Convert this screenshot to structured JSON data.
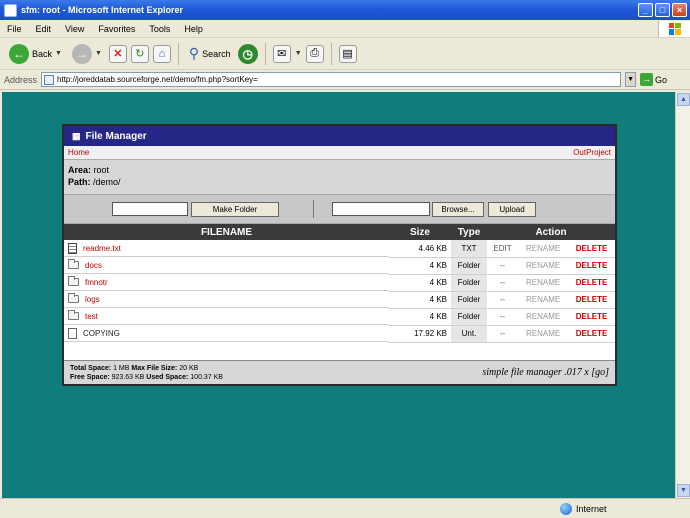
{
  "window": {
    "title": "sfm: root - Microsoft Internet Explorer",
    "minimize": "_",
    "maximize": "□",
    "close": "×"
  },
  "menu": [
    "File",
    "Edit",
    "View",
    "Favorites",
    "Tools",
    "Help"
  ],
  "toolbar": {
    "back_label": "Back",
    "search_label": "Search"
  },
  "address": {
    "label": "Address",
    "url": "http://joreddatab.sourceforge.net/demo/fm.php?sortKey=",
    "go_label": "Go"
  },
  "statusbar": {
    "zone": "Internet"
  },
  "file_manager": {
    "title": "File Manager",
    "home_link": "Home",
    "logout_link": "OutProject",
    "area_label": "Area:",
    "area_value": "root",
    "path_label": "Path:",
    "path_value": "/demo/",
    "make_folder_button": "Make Folder",
    "browse_button": "Browse...",
    "upload_button": "Upload",
    "columns": {
      "filename": "FILENAME",
      "size": "Size",
      "type": "Type",
      "action": "Action"
    },
    "files": [
      {
        "name": "readme.txt",
        "size": "4.46 KB",
        "type": "TXT",
        "edit": "EDIT",
        "rename": "RENAME",
        "delete": "DELETE",
        "icon": "text-file-icon"
      },
      {
        "name": "docs",
        "size": "4 KB",
        "type": "Folder",
        "edit": "--",
        "rename": "RENAME",
        "delete": "DELETE",
        "icon": "folder-icon"
      },
      {
        "name": "fmnotr",
        "size": "4 KB",
        "type": "Folder",
        "edit": "--",
        "rename": "RENAME",
        "delete": "DELETE",
        "icon": "folder-icon"
      },
      {
        "name": "logs",
        "size": "4 KB",
        "type": "Folder",
        "edit": "--",
        "rename": "RENAME",
        "delete": "DELETE",
        "icon": "folder-icon"
      },
      {
        "name": "test",
        "size": "4 KB",
        "type": "Folder",
        "edit": "--",
        "rename": "RENAME",
        "delete": "DELETE",
        "icon": "folder-icon"
      },
      {
        "name": "COPYING",
        "size": "17.92 KB",
        "type": "Unt.",
        "edit": "--",
        "rename": "RENAME",
        "delete": "DELETE",
        "icon": "file-icon"
      }
    ],
    "footer": {
      "total_space_label": "Total Space:",
      "total_space_value": "1 MB",
      "max_file_label": "Max File Size:",
      "max_file_value": "20 KB",
      "free_space_label": "Free Space:",
      "free_space_value": "923.63 KB",
      "used_space_label": "Used Space:",
      "used_space_value": "100.37 KB",
      "brand": "simple file manager .017 x [go]"
    }
  }
}
